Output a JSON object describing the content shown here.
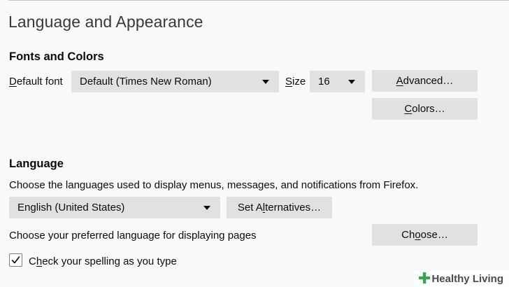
{
  "section_title": "Language and Appearance",
  "fonts_and_colors": {
    "heading": "Fonts and Colors",
    "default_font_label_mnemonic": "D",
    "default_font_label_rest": "efault font",
    "default_font_value": "Default (Times New Roman)",
    "size_label_mnemonic": "S",
    "size_label_rest": "ize",
    "size_value": "16",
    "advanced_mnemonic": "A",
    "advanced_rest": "dvanced…",
    "colors_mnemonic": "C",
    "colors_rest": "olors…"
  },
  "language": {
    "heading": "Language",
    "description": "Choose the languages used to display menus, messages, and notifications from Firefox.",
    "ui_language_value": "English (United States)",
    "set_alternatives_before": "Set A",
    "set_alternatives_mnemonic": "l",
    "set_alternatives_after": "ternatives…",
    "page_language_label": "Choose your preferred language for displaying pages",
    "choose_before": "Ch",
    "choose_mnemonic": "o",
    "choose_after": "ose…",
    "spellcheck_label_before": "C",
    "spellcheck_label_mnemonic": "h",
    "spellcheck_label_after": "eck your spelling as you type",
    "spellcheck_checked": true
  },
  "watermark": {
    "text": "Healthy Living",
    "accent_color": "#2fa84f"
  },
  "colors": {
    "background": "#f9f9fa",
    "control_background": "#e1e1e4",
    "text": "#0c0c0d"
  }
}
